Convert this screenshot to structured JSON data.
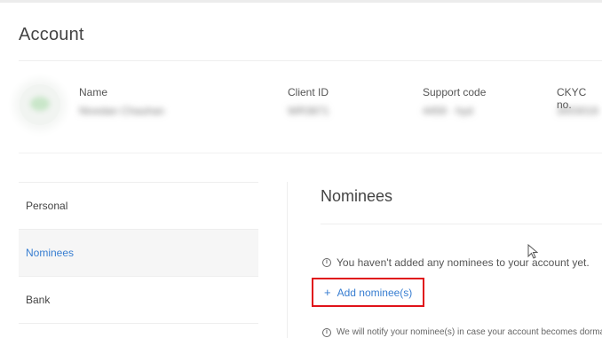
{
  "header": {
    "title": "Account"
  },
  "profile": {
    "name_label": "Name",
    "name_value": "Nivedan Chauhan",
    "client_id_label": "Client ID",
    "client_id_value": "WR3871",
    "support_code_label": "Support code",
    "support_code_value": "4459 · hyd",
    "ckyc_label": "CKYC no.",
    "ckyc_value": "3003019"
  },
  "sidebar": {
    "items": [
      {
        "label": "Personal",
        "active": false
      },
      {
        "label": "Nominees",
        "active": true
      },
      {
        "label": "Bank",
        "active": false
      }
    ]
  },
  "main": {
    "section_title": "Nominees",
    "info_text": "You haven't added any nominees to your account yet.",
    "add_button_label": "Add nominee(s)",
    "notify_text": "We will notify your nominee(s) in case your account becomes dormant."
  },
  "colors": {
    "accent": "#387ed1",
    "highlight_border": "#e0131a",
    "active_bg": "#f6f6f6"
  },
  "icons": [
    "info-icon",
    "plus-icon",
    "mouse-cursor-icon"
  ]
}
